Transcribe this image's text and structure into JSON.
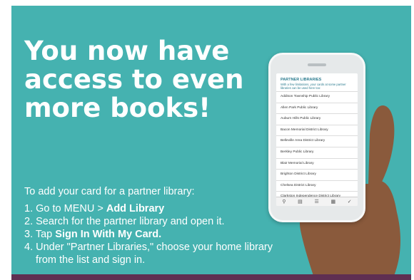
{
  "colors": {
    "panel": "#45b2b0",
    "text": "#ffffff",
    "bottom_bar": "#5f2f52",
    "screen_accent": "#2e7d90"
  },
  "headline": [
    "You now have",
    "access to even",
    "more books!"
  ],
  "intro": "To add your card for a partner library:",
  "steps": [
    {
      "num": "1. ",
      "text": "Go to MENU > ",
      "bold": "Add Library",
      "after": ""
    },
    {
      "num": "2. ",
      "text": "Search for the partner library and open it.",
      "bold": "",
      "after": ""
    },
    {
      "num": "3. ",
      "text": "Tap ",
      "bold": "Sign In With My Card.",
      "after": ""
    },
    {
      "num": "4. ",
      "text": "Under \"Partner Libraries,\" choose your home library",
      "bold": "",
      "after": "",
      "cont": "from the list and sign in."
    }
  ],
  "phone": {
    "title": "PARTNER LIBRARIES",
    "subtitle": "With a few limitations, your cards at some partner libraries can be used here too:",
    "libraries": [
      "Addison Township Public Library",
      "Allen Park Public Library",
      "Auburn Hills Public Library",
      "Bacon Memorial District Library",
      "Belleville Area District Library",
      "Berkley Public Library",
      "Blair Memorial Library",
      "Brighton District Library",
      "Chelsea District Library",
      "Clarkston Independence District Library"
    ],
    "nav_icons": [
      "search-icon",
      "books-icon",
      "menu-icon",
      "shelf-icon",
      "check-icon"
    ]
  }
}
